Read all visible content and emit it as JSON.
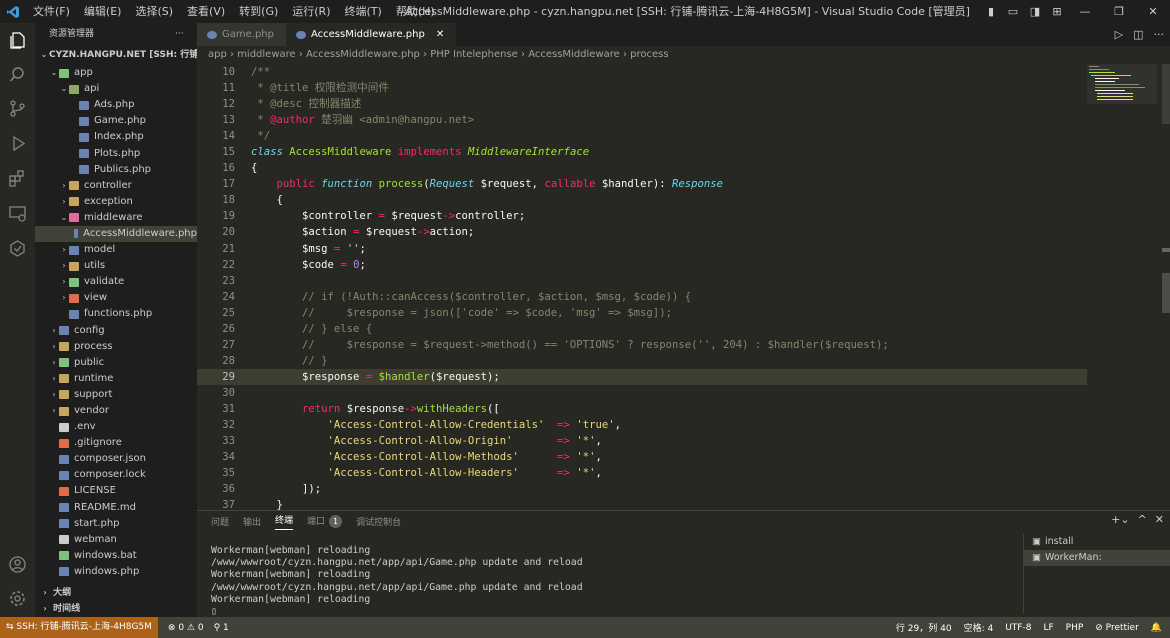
{
  "titlebar": {
    "menu": [
      "文件(F)",
      "编辑(E)",
      "选择(S)",
      "查看(V)",
      "转到(G)",
      "运行(R)",
      "终端(T)",
      "帮助(H)"
    ],
    "title": "AccessMiddleware.php - cyzn.hangpu.net [SSH: 行铺-腾讯云-上海-4H8G5M] - Visual Studio Code [管理员]"
  },
  "sidebar": {
    "title": "资源管理器",
    "root": "CYZN.HANGPU.NET [SSH: 行铺-腾讯...",
    "items": [
      {
        "label": "app",
        "indent": 0,
        "chev": "⌄",
        "color": "#7fc37a"
      },
      {
        "label": "api",
        "indent": 1,
        "chev": "⌄",
        "color": "#8da866"
      },
      {
        "label": "Ads.php",
        "indent": 2,
        "chev": "",
        "color": "#6b83b4"
      },
      {
        "label": "Game.php",
        "indent": 2,
        "chev": "",
        "color": "#6b83b4"
      },
      {
        "label": "Index.php",
        "indent": 2,
        "chev": "",
        "color": "#6b83b4"
      },
      {
        "label": "Plots.php",
        "indent": 2,
        "chev": "",
        "color": "#6b83b4"
      },
      {
        "label": "Publics.php",
        "indent": 2,
        "chev": "",
        "color": "#6b83b4"
      },
      {
        "label": "controller",
        "indent": 1,
        "chev": "›",
        "color": "#c9a45c"
      },
      {
        "label": "exception",
        "indent": 1,
        "chev": "›",
        "color": "#c9a45c"
      },
      {
        "label": "middleware",
        "indent": 1,
        "chev": "⌄",
        "color": "#e06c9f"
      },
      {
        "label": "AccessMiddleware.php",
        "indent": 2,
        "chev": "",
        "color": "#6b83b4",
        "selected": true
      },
      {
        "label": "model",
        "indent": 1,
        "chev": "›",
        "color": "#6b83b4"
      },
      {
        "label": "utils",
        "indent": 1,
        "chev": "›",
        "color": "#c9a45c"
      },
      {
        "label": "validate",
        "indent": 1,
        "chev": "›",
        "color": "#7fc37a"
      },
      {
        "label": "view",
        "indent": 1,
        "chev": "›",
        "color": "#e36b4c"
      },
      {
        "label": "functions.php",
        "indent": 1,
        "chev": "",
        "color": "#6b83b4"
      },
      {
        "label": "config",
        "indent": 0,
        "chev": "›",
        "color": "#6b83b4"
      },
      {
        "label": "process",
        "indent": 0,
        "chev": "›",
        "color": "#c9a45c"
      },
      {
        "label": "public",
        "indent": 0,
        "chev": "›",
        "color": "#7fc37a"
      },
      {
        "label": "runtime",
        "indent": 0,
        "chev": "›",
        "color": "#c9a45c"
      },
      {
        "label": "support",
        "indent": 0,
        "chev": "›",
        "color": "#c9a45c"
      },
      {
        "label": "vendor",
        "indent": 0,
        "chev": "›",
        "color": "#c9a45c"
      },
      {
        "label": ".env",
        "indent": 0,
        "chev": "",
        "color": "#cccccc"
      },
      {
        "label": ".gitignore",
        "indent": 0,
        "chev": "",
        "color": "#e36b4c"
      },
      {
        "label": "composer.json",
        "indent": 0,
        "chev": "",
        "color": "#6b83b4"
      },
      {
        "label": "composer.lock",
        "indent": 0,
        "chev": "",
        "color": "#6b83b4"
      },
      {
        "label": "LICENSE",
        "indent": 0,
        "chev": "",
        "color": "#e36b4c"
      },
      {
        "label": "README.md",
        "indent": 0,
        "chev": "",
        "color": "#6b83b4"
      },
      {
        "label": "start.php",
        "indent": 0,
        "chev": "",
        "color": "#6b83b4"
      },
      {
        "label": "webman",
        "indent": 0,
        "chev": "",
        "color": "#cccccc"
      },
      {
        "label": "windows.bat",
        "indent": 0,
        "chev": "",
        "color": "#7fc37a"
      },
      {
        "label": "windows.php",
        "indent": 0,
        "chev": "",
        "color": "#6b83b4"
      }
    ],
    "outline": "大纲",
    "timeline": "时间线"
  },
  "tabs": [
    {
      "label": "Game.php",
      "active": false
    },
    {
      "label": "AccessMiddleware.php",
      "active": true,
      "close": "✕"
    }
  ],
  "breadcrumb": [
    "app",
    "middleware",
    "AccessMiddleware.php",
    "PHP Intelephense",
    "AccessMiddleware",
    "process"
  ],
  "code": [
    {
      "n": "10",
      "t": [
        [
          "c-cm",
          "/**"
        ]
      ]
    },
    {
      "n": "11",
      "t": [
        [
          "c-cm",
          " * @title 权限检测中间件"
        ]
      ]
    },
    {
      "n": "12",
      "t": [
        [
          "c-cm",
          " * @desc 控制器描述"
        ]
      ]
    },
    {
      "n": "13",
      "t": [
        [
          "c-cm",
          " * "
        ],
        [
          "c-at",
          "@author"
        ],
        [
          "c-cm",
          " 楚羽幽 <admin@hangpu.net>"
        ]
      ]
    },
    {
      "n": "14",
      "t": [
        [
          "c-cm",
          " */"
        ]
      ]
    },
    {
      "n": "15",
      "t": [
        [
          "c-sto",
          "class "
        ],
        [
          "c-cls",
          "AccessMiddleware "
        ],
        [
          "c-kw",
          "implements "
        ],
        [
          "c-itf",
          "MiddlewareInterface"
        ]
      ]
    },
    {
      "n": "16",
      "t": [
        [
          "c-var",
          "{"
        ]
      ]
    },
    {
      "n": "17",
      "t": [
        [
          "c-var",
          "    "
        ],
        [
          "c-kw",
          "public "
        ],
        [
          "c-sto",
          "function "
        ],
        [
          "c-fn",
          "process"
        ],
        [
          "c-var",
          "("
        ],
        [
          "c-typ",
          "Request "
        ],
        [
          "c-var",
          "$request, "
        ],
        [
          "c-kw",
          "callable "
        ],
        [
          "c-var",
          "$handler): "
        ],
        [
          "c-typ",
          "Response"
        ]
      ]
    },
    {
      "n": "18",
      "t": [
        [
          "c-var",
          "    {"
        ]
      ]
    },
    {
      "n": "19",
      "t": [
        [
          "c-var",
          "        $controller "
        ],
        [
          "c-op",
          "="
        ],
        [
          "c-var",
          " $request"
        ],
        [
          "c-op",
          "->"
        ],
        [
          "c-var",
          "controller;"
        ]
      ]
    },
    {
      "n": "20",
      "t": [
        [
          "c-var",
          "        $action "
        ],
        [
          "c-op",
          "="
        ],
        [
          "c-var",
          " $request"
        ],
        [
          "c-op",
          "->"
        ],
        [
          "c-var",
          "action;"
        ]
      ]
    },
    {
      "n": "21",
      "t": [
        [
          "c-var",
          "        $msg "
        ],
        [
          "c-op",
          "="
        ],
        [
          "c-var",
          " "
        ],
        [
          "c-str",
          "''"
        ],
        [
          "c-var",
          ";"
        ]
      ]
    },
    {
      "n": "22",
      "t": [
        [
          "c-var",
          "        $code "
        ],
        [
          "c-op",
          "="
        ],
        [
          "c-var",
          " "
        ],
        [
          "c-num",
          "0"
        ],
        [
          "c-var",
          ";"
        ]
      ]
    },
    {
      "n": "23",
      "t": [
        [
          "c-var",
          ""
        ]
      ]
    },
    {
      "n": "24",
      "t": [
        [
          "c-cm",
          "        // if (!Auth::canAccess($controller, $action, $msg, $code)) {"
        ]
      ]
    },
    {
      "n": "25",
      "t": [
        [
          "c-cm",
          "        //     $response = json(['code' => $code, 'msg' => $msg]);"
        ]
      ]
    },
    {
      "n": "26",
      "t": [
        [
          "c-cm",
          "        // } else {"
        ]
      ]
    },
    {
      "n": "27",
      "t": [
        [
          "c-cm",
          "        //     $response = $request->method() == 'OPTIONS' ? response('', 204) : $handler($request);"
        ]
      ]
    },
    {
      "n": "28",
      "t": [
        [
          "c-cm",
          "        // }"
        ]
      ]
    },
    {
      "n": "29",
      "t": [
        [
          "c-var",
          "        $response "
        ],
        [
          "c-op",
          "="
        ],
        [
          "c-var",
          " "
        ],
        [
          "c-fn",
          "$handler"
        ],
        [
          "c-var",
          "($request);"
        ]
      ],
      "current": true
    },
    {
      "n": "30",
      "t": [
        [
          "c-var",
          ""
        ]
      ]
    },
    {
      "n": "31",
      "t": [
        [
          "c-var",
          "        "
        ],
        [
          "c-kw",
          "return "
        ],
        [
          "c-var",
          "$response"
        ],
        [
          "c-op",
          "->"
        ],
        [
          "c-fn",
          "withHeaders"
        ],
        [
          "c-var",
          "(["
        ]
      ]
    },
    {
      "n": "32",
      "t": [
        [
          "c-var",
          "            "
        ],
        [
          "c-str",
          "'Access-Control-Allow-Credentials'"
        ],
        [
          "c-var",
          "  "
        ],
        [
          "c-op",
          "=>"
        ],
        [
          "c-var",
          " "
        ],
        [
          "c-str",
          "'true'"
        ],
        [
          "c-var",
          ","
        ]
      ]
    },
    {
      "n": "33",
      "t": [
        [
          "c-var",
          "            "
        ],
        [
          "c-str",
          "'Access-Control-Allow-Origin'"
        ],
        [
          "c-var",
          "       "
        ],
        [
          "c-op",
          "=>"
        ],
        [
          "c-var",
          " "
        ],
        [
          "c-str",
          "'*'"
        ],
        [
          "c-var",
          ","
        ]
      ]
    },
    {
      "n": "34",
      "t": [
        [
          "c-var",
          "            "
        ],
        [
          "c-str",
          "'Access-Control-Allow-Methods'"
        ],
        [
          "c-var",
          "      "
        ],
        [
          "c-op",
          "=>"
        ],
        [
          "c-var",
          " "
        ],
        [
          "c-str",
          "'*'"
        ],
        [
          "c-var",
          ","
        ]
      ]
    },
    {
      "n": "35",
      "t": [
        [
          "c-var",
          "            "
        ],
        [
          "c-str",
          "'Access-Control-Allow-Headers'"
        ],
        [
          "c-var",
          "      "
        ],
        [
          "c-op",
          "=>"
        ],
        [
          "c-var",
          " "
        ],
        [
          "c-str",
          "'*'"
        ],
        [
          "c-var",
          ","
        ]
      ]
    },
    {
      "n": "36",
      "t": [
        [
          "c-var",
          "        ]);"
        ]
      ]
    },
    {
      "n": "37",
      "t": [
        [
          "c-var",
          "    }"
        ]
      ]
    }
  ],
  "panel": {
    "tabs": [
      "问题",
      "输出",
      "终端",
      "端口",
      "调试控制台"
    ],
    "port_badge": "1",
    "terminal_lines": [
      "Workerman[webman] reloading",
      "/www/wwwroot/cyzn.hangpu.net/app/api/Game.php update and reload",
      "Workerman[webman] reloading",
      "/www/wwwroot/cyzn.hangpu.net/app/api/Game.php update and reload",
      "Workerman[webman] reloading",
      ""
    ],
    "terminals": [
      "install",
      "WorkerMan:"
    ]
  },
  "status": {
    "remote": "SSH: 行铺-腾讯云-上海-4H8G5M",
    "problems": "⊗ 0 ⚠ 0",
    "ports": "1",
    "position": "行 29，列 40",
    "spaces": "空格: 4",
    "encoding": "UTF-8",
    "eol": "LF",
    "language": "PHP",
    "prettier": "Prettier"
  }
}
